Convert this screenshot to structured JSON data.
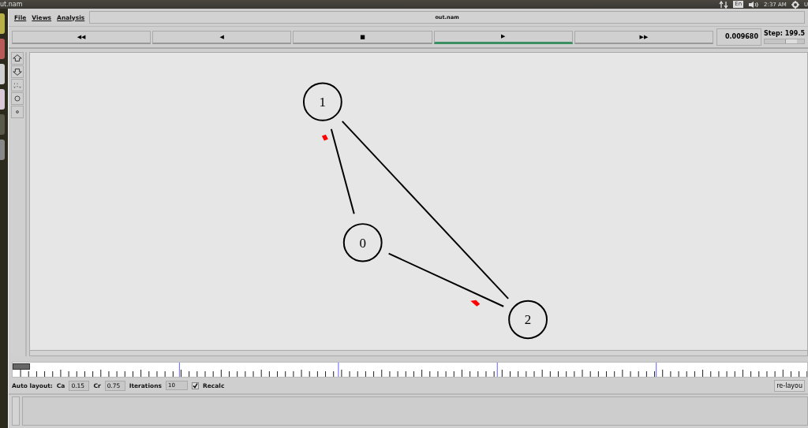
{
  "top_bar": {
    "window_title": "ut.nam",
    "keyboard": "En",
    "clock": "2:37 AM",
    "user": "U"
  },
  "menu": [
    "File",
    "Views",
    "Analysis"
  ],
  "title_field": "out.nam",
  "playback": [
    {
      "glyph": "◀◀",
      "selected": false
    },
    {
      "glyph": "◀",
      "selected": false
    },
    {
      "glyph": "■",
      "selected": false
    },
    {
      "glyph": "▶",
      "selected": true
    },
    {
      "glyph": "▶▶",
      "selected": false
    }
  ],
  "time": "0.009680",
  "step": {
    "label": "Step: 199.5",
    "level": 0.75
  },
  "nodes": [
    {
      "label": "1"
    },
    {
      "label": "0"
    },
    {
      "label": "2"
    }
  ],
  "timeline": {
    "level": 0
  },
  "auto_layout": {
    "label": "Auto layout:",
    "ca_label": "Ca",
    "ca": "0.15",
    "cr_label": "Cr",
    "cr": "0.75",
    "iterations_label": "Iterations",
    "iterations": "10",
    "recalc": {
      "label": "Recalc",
      "checked": true
    },
    "button": "re-layou"
  }
}
